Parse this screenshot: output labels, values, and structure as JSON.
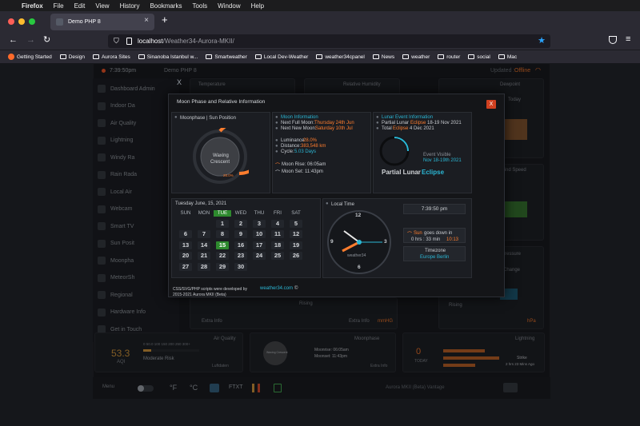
{
  "mac_menu": {
    "apple": "",
    "items": [
      "Firefox",
      "File",
      "Edit",
      "View",
      "History",
      "Bookmarks",
      "Tools",
      "Window",
      "Help"
    ]
  },
  "tab": {
    "title": "Demo PHP 8",
    "close": "×",
    "new_tab": "+"
  },
  "url": {
    "host": "localhost",
    "path": "/Weather34-Aurora-MKII/"
  },
  "bookmarks": [
    "Getting Started",
    "Design",
    "Aurora Sites",
    "Sinanoba Istanbul w...",
    "Smartweather",
    "Local Dev-Weather",
    "weather34cpanel",
    "News",
    "weather",
    "router",
    "social",
    "Mac"
  ],
  "header": {
    "time": "7:39:50pm",
    "station": "Demo PHP 8",
    "updated": "Updated :",
    "status": "Offline"
  },
  "sidebar": {
    "items": [
      "Dashboard Admin",
      "Indoor Da",
      "Air Quality",
      "Lightning",
      "Windy Ra",
      "Rain Rada",
      "Local Air",
      "Webcam",
      "Smart TV",
      "Sun Posit",
      "Moonpha",
      "MeteorSh",
      "Regional",
      "Hardware Info",
      "Get in Touch"
    ]
  },
  "background_cards": {
    "temperature": "Temperature",
    "humidity": "Relative Humidity",
    "dewpoint": "Dewpoint",
    "today": "Today",
    "wind_speed": "Wind Speed",
    "pressure": "Pressure",
    "change": "Change",
    "air_quality": {
      "title": "Air Quality",
      "value": "53.3",
      "unit": "AQI",
      "risk": "Moderate Risk",
      "scale": "0 50.0 100 150 200 250 300+",
      "extra": "Luftdaten"
    },
    "moonphase": {
      "title": "Moonphase",
      "moonrise": "Moonrise: 06:05am",
      "moonset": "Moonset: 11:43pm",
      "phase": "Waxing Crescent",
      "extra": "Extra Info"
    },
    "lightning": {
      "title": "Lightning",
      "count": "0",
      "label": "TODAY",
      "strike": "Strike",
      "ago": "2 hrs 23 Mins Ago"
    },
    "extra_info": "Extra Info",
    "rising": "Rising",
    "mmhg": "mmHG",
    "hpa": "hPa"
  },
  "modal": {
    "title": "Moon Phase and Relative Information",
    "close": "X",
    "moonphase_panel": {
      "heading": "Moonphase | Sun Position",
      "phase_line1": "Waxing",
      "phase_line2": "Crescent",
      "pct": "28.0%"
    },
    "moon_info": {
      "heading": "Moon Information",
      "full_label": "Next Full Moon:",
      "full_value": "Thursday 24th Jun",
      "new_label": "Next New Moon:",
      "new_value": "Saturday 10th Jul",
      "lum_label": "Luminance:",
      "lum_value": "28.0%",
      "dist_label": "Distance:",
      "dist_value": "383,548 km",
      "cycle_label": "Cycle:",
      "cycle_value": "5.03 Days",
      "rise": "Moon Rise: 06:05am",
      "set": "Moon Set: 11:43pm"
    },
    "lunar_event": {
      "heading": "Lunar Event Information",
      "partial_label": "Partial Lunar",
      "partial_eclipse": "Eclipse",
      "partial_dates": "18-19 Nov 2021",
      "total_label": "Total",
      "total_eclipse": "Eclipse",
      "total_dates": "4 Dec 2021",
      "visible_label": "Event Visible",
      "visible_dates": "Nov 18-19th 2021",
      "big_label": "Partial Lunar",
      "big_eclipse": "Eclipse"
    },
    "calendar": {
      "date": "Tuesday June, 15, 2021",
      "days": [
        "SUN",
        "MON",
        "TUE",
        "WED",
        "THU",
        "FRI",
        "SAT"
      ],
      "weeks": [
        [
          "",
          "",
          "1",
          "2",
          "3",
          "4",
          "5"
        ],
        [
          "6",
          "7",
          "8",
          "9",
          "10",
          "11",
          "12"
        ],
        [
          "13",
          "14",
          "15",
          "16",
          "17",
          "18",
          "19"
        ],
        [
          "20",
          "21",
          "22",
          "23",
          "24",
          "25",
          "26"
        ],
        [
          "27",
          "28",
          "29",
          "30",
          "",
          "",
          ""
        ]
      ],
      "today": "15"
    },
    "local_time": {
      "heading": "Local Time",
      "clock_brand": "weather34",
      "n12": "12",
      "n3": "3",
      "n6": "6",
      "n9": "9",
      "digital": "7:39:50 pm",
      "sun_label": "Sun",
      "sun_text": "goes down in",
      "sun_time": "0 hrs : 33 min",
      "sun_mins": "10:13",
      "tz_label": "Timezone",
      "tz_value": "Europe Berlin"
    },
    "footer": {
      "line1": "CSS/SVG/PHP scripts were developed by",
      "link": "weather34.com",
      "symbol": "©",
      "line2": "2015-2021 Aurora MKII (Beta)"
    }
  },
  "bottom_bar": {
    "menu": "Menu",
    "f": "°F",
    "c": "°C",
    "ftxt": "FTXT",
    "brand": "Aurora MKII (Beta) Vantage"
  }
}
